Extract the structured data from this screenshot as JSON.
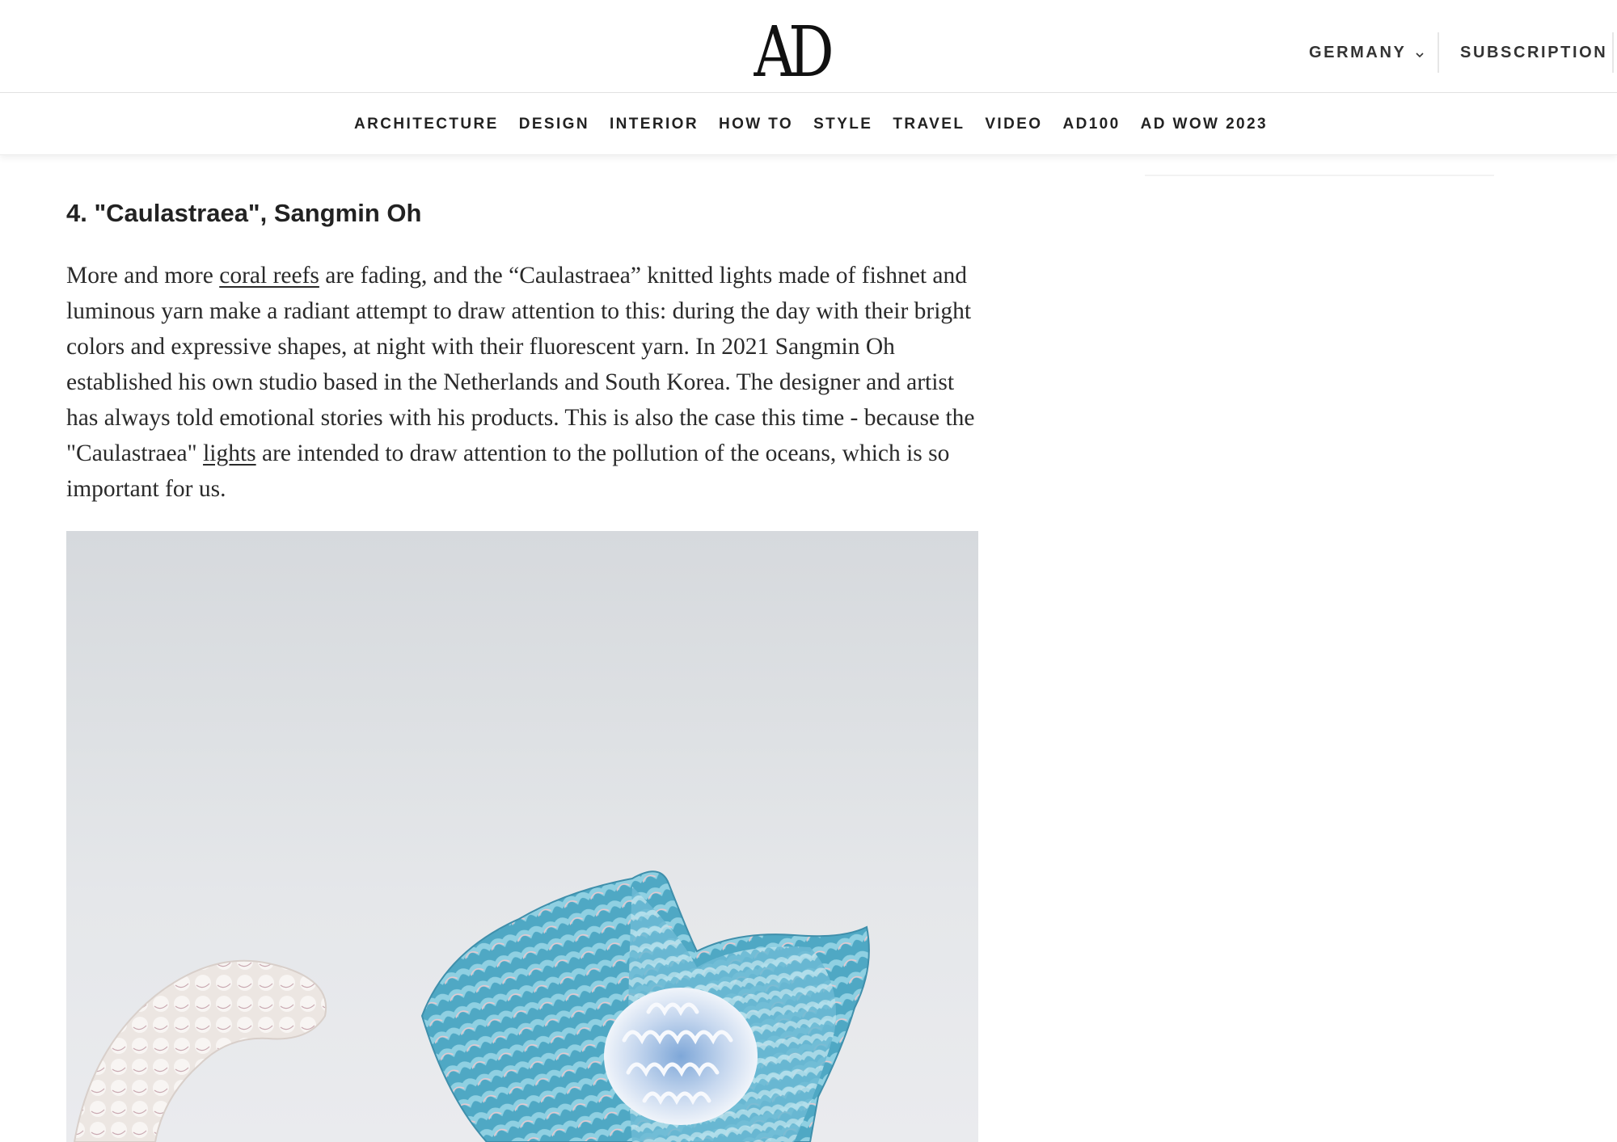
{
  "header": {
    "logo_text": "AD",
    "country": "GERMANY",
    "subscription": "SUBSCRIPTION"
  },
  "nav": {
    "items": [
      {
        "label": "ARCHITECTURE"
      },
      {
        "label": "DESIGN"
      },
      {
        "label": "INTERIOR"
      },
      {
        "label": "HOW TO"
      },
      {
        "label": "STYLE"
      },
      {
        "label": "TRAVEL"
      },
      {
        "label": "VIDEO"
      },
      {
        "label": "AD100"
      },
      {
        "label": "AD WOW 2023"
      }
    ]
  },
  "article": {
    "heading": "4. \"Caulastraea\", Sangmin Oh",
    "paragraph": {
      "t1": "More and more ",
      "link1": "coral reefs",
      "t2": " are fading, and the “Caulastraea” knitted lights made of fishnet and luminous yarn make a radiant attempt to draw attention to this: during the day with their bright colors and expressive shapes, at night with their fluorescent yarn. In 2021 Sangmin Oh established his own studio based in the Netherlands and South Korea. The designer and artist has always told emotional stories with his products. This is also the case this time - because the \"Caulastraea\" ",
      "link2": "lights",
      "t3": " are intended to draw attention to the pollution of the oceans, which is so important for us."
    }
  },
  "colors": {
    "text": "#2a2a2a",
    "photo_wall": "#dde0e3",
    "knit_blue": "#5fb3cc",
    "knit_white": "#efe9e4"
  }
}
